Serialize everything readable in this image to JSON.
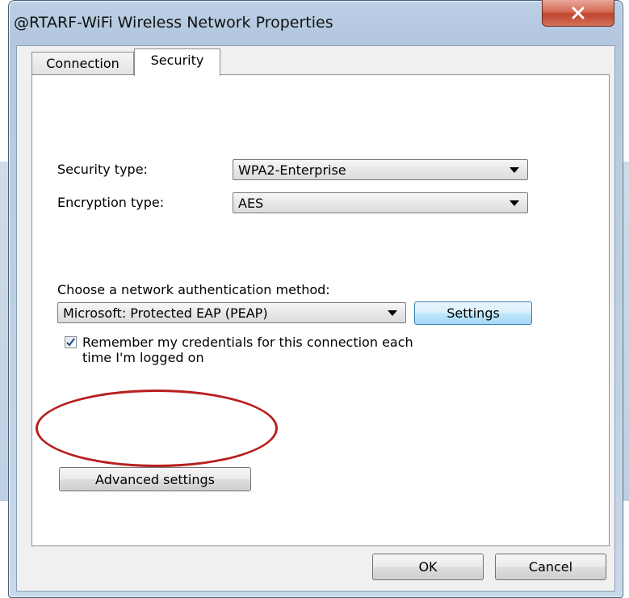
{
  "window": {
    "title": "@RTARF-WiFi Wireless Network Properties",
    "close_label": "✕"
  },
  "tabs": [
    {
      "label": "Connection",
      "selected": false
    },
    {
      "label": "Security",
      "selected": true
    }
  ],
  "security": {
    "security_type_label": "Security type:",
    "security_type_value": "WPA2-Enterprise",
    "encryption_type_label": "Encryption type:",
    "encryption_type_value": "AES",
    "auth_method_label": "Choose a network authentication method:",
    "auth_method_value": "Microsoft: Protected EAP (PEAP)",
    "settings_button": "Settings",
    "remember_checked": true,
    "remember_line1": "Remember my credentials for this connection each",
    "remember_line2": "time I'm logged on",
    "advanced_button": "Advanced settings"
  },
  "footer": {
    "ok_label": "OK",
    "cancel_label": "Cancel"
  },
  "colors": {
    "highlight_ring": "#b81f1f",
    "close_button": "#c8503a"
  }
}
